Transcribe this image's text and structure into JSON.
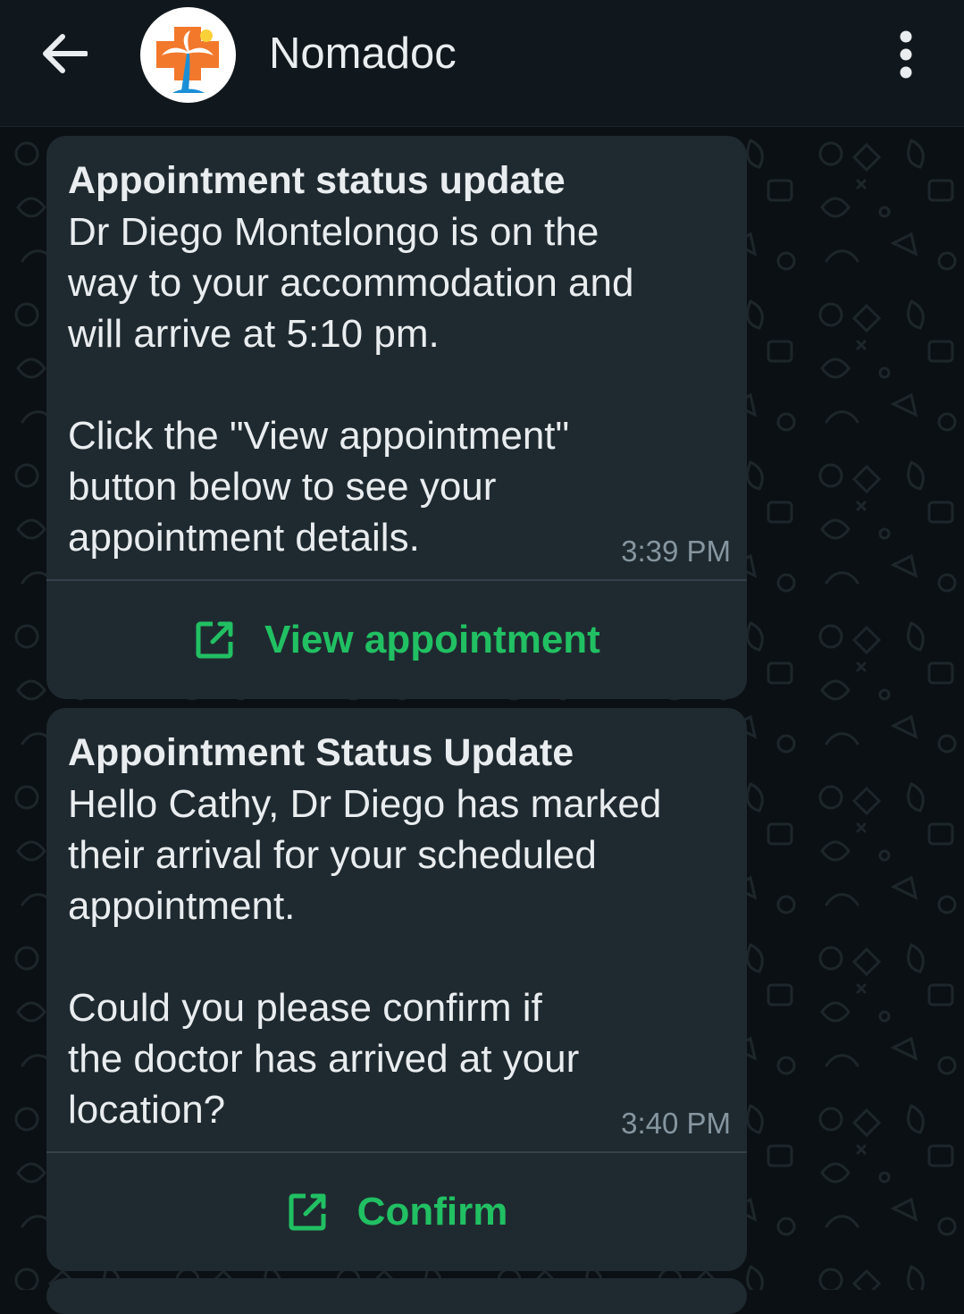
{
  "header": {
    "back_icon": "arrow-left-icon",
    "avatar_icon": "nomadoc-logo",
    "title": "Nomadoc",
    "menu_icon": "more-vert-icon"
  },
  "messages": [
    {
      "title": "Appointment status update",
      "text": "Dr Diego Montelongo is on the\nway to your accommodation and\nwill arrive at 5:10 pm.\n\nClick the \"View appointment\"\nbutton below to see your\nappointment details.",
      "time": "3:39 PM",
      "action_label": "View appointment",
      "action_icon": "external-link-icon"
    },
    {
      "title": "Appointment Status Update",
      "text": "Hello Cathy, Dr Diego has marked\ntheir arrival for your scheduled\nappointment.\n\nCould you please confirm if\nthe doctor has arrived at your\nlocation?",
      "time": "3:40 PM",
      "action_label": "Confirm",
      "action_icon": "external-link-icon"
    }
  ],
  "colors": {
    "accent": "#21c063",
    "bubble": "#1f2a30",
    "header": "#11181d",
    "background": "#0b1014"
  }
}
